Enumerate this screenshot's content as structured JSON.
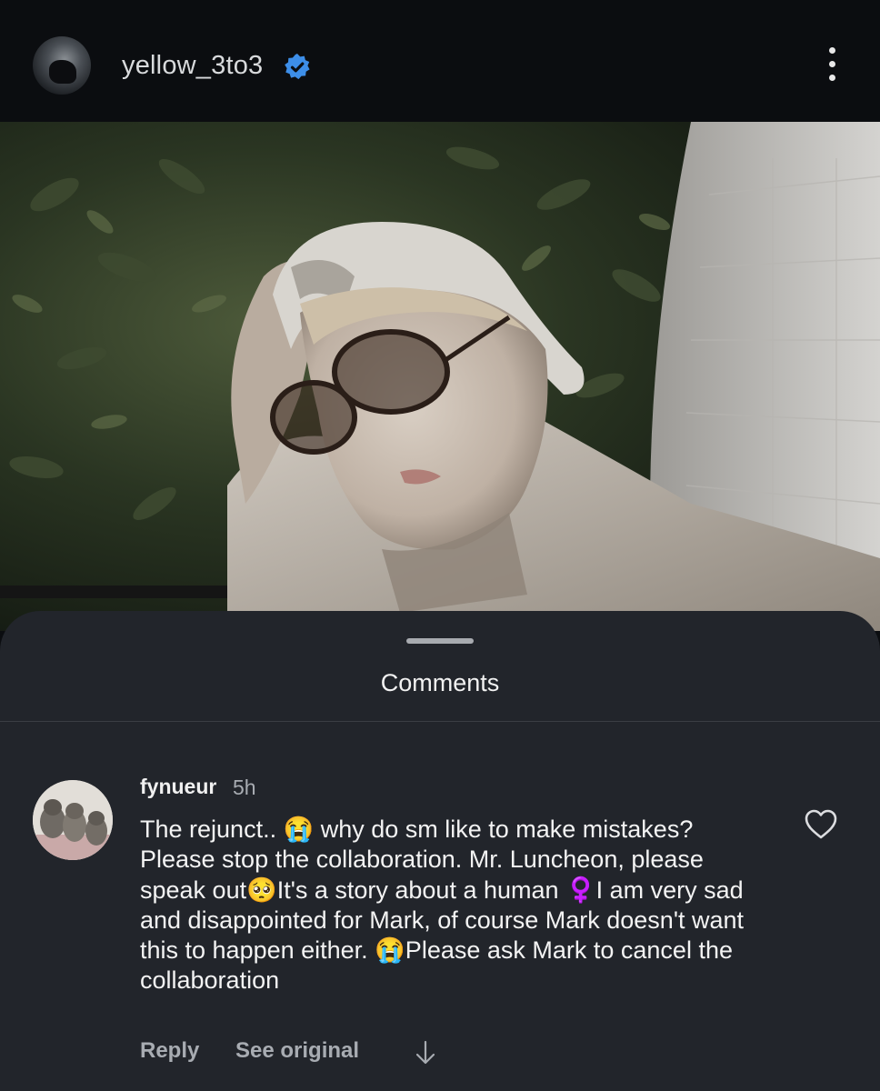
{
  "header": {
    "username": "yellow_3to3",
    "verified_icon": "verified-badge-icon",
    "menu_icon": "more-vertical-icon"
  },
  "sheet": {
    "title": "Comments"
  },
  "comment": {
    "username": "fynueur",
    "time": "5h",
    "text": "The rejunct.. 😭 why do sm like to make mistakes? Please stop the collaboration. Mr. Luncheon, please speak out🥺It's a story about a human ♀️I am very sad and disappointed for Mark, of course Mark doesn't want this to happen either. 😭Please ask Mark to cancel the collaboration",
    "reply_label": "Reply",
    "see_original_label": "See original",
    "like_icon": "heart-outline-icon",
    "expand_icon": "arrow-down-icon"
  },
  "colors": {
    "background": "#0b0d10",
    "sheet": "#22252b",
    "verified": "#3d8ee8",
    "muted_text": "#a8acb2"
  }
}
